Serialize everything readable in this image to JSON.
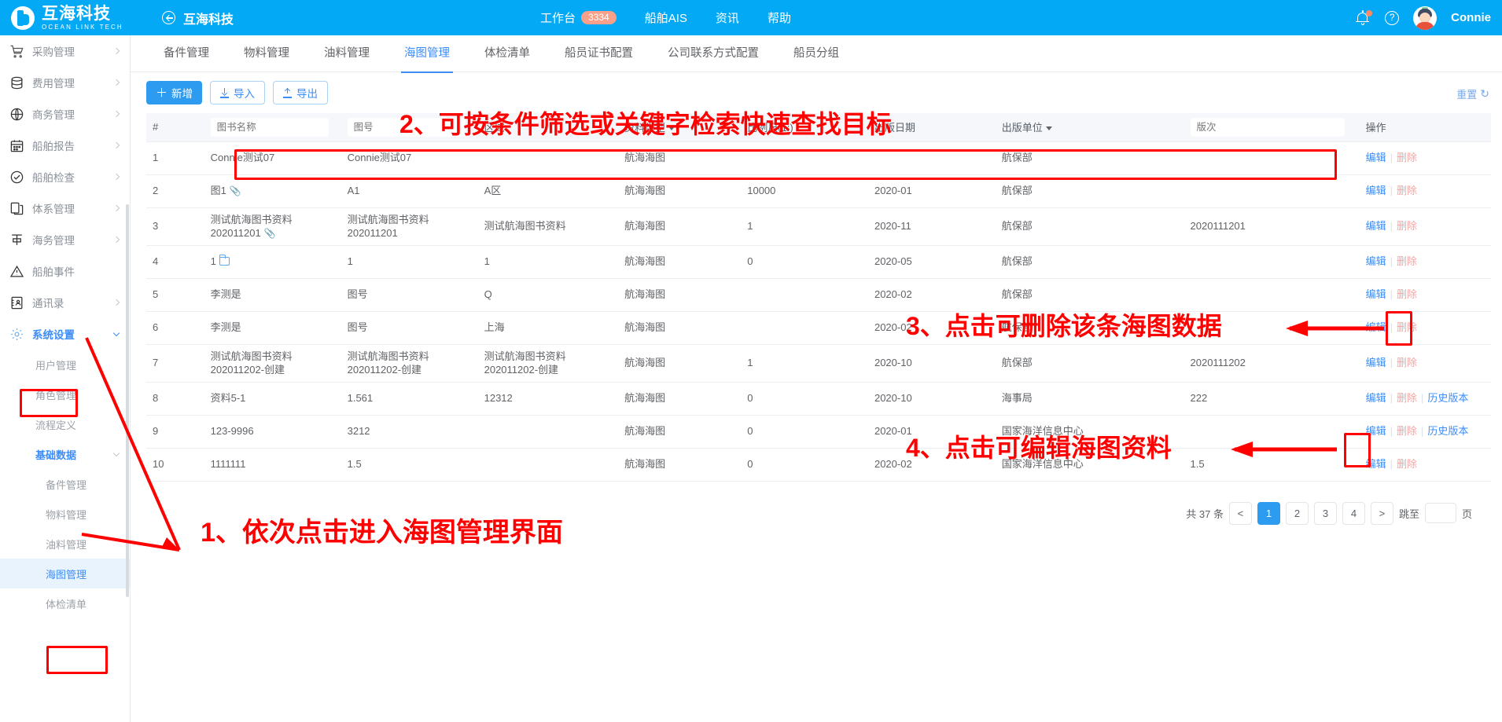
{
  "header": {
    "brand_cn": "互海科技",
    "brand_en": "OCEAN LINK TECH",
    "back_label": "互海科技",
    "nav": [
      {
        "label": "工作台",
        "badge": "3334"
      },
      {
        "label": "船舶AIS",
        "badge": ""
      },
      {
        "label": "资讯",
        "badge": ""
      },
      {
        "label": "帮助",
        "badge": ""
      }
    ],
    "user_name": "Connie"
  },
  "sidebar": {
    "items": [
      {
        "label": "采购管理",
        "icon": "cart-icon",
        "chevron": "right"
      },
      {
        "label": "费用管理",
        "icon": "database-icon",
        "chevron": "right"
      },
      {
        "label": "商务管理",
        "icon": "globe-icon",
        "chevron": "right"
      },
      {
        "label": "船舶报告",
        "icon": "calendar-icon",
        "chevron": "right"
      },
      {
        "label": "船舶检查",
        "icon": "check-circle-icon",
        "chevron": "right"
      },
      {
        "label": "体系管理",
        "icon": "documents-icon",
        "chevron": "right"
      },
      {
        "label": "海务管理",
        "icon": "anchor-icon",
        "chevron": "right"
      },
      {
        "label": "船舶事件",
        "icon": "warning-icon",
        "chevron": ""
      },
      {
        "label": "通讯录",
        "icon": "contacts-icon",
        "chevron": "right"
      },
      {
        "label": "系统设置",
        "icon": "gear-icon",
        "chevron": "down",
        "active": true
      }
    ],
    "sub_items": [
      {
        "label": "用户管理",
        "level": 1
      },
      {
        "label": "角色管理",
        "level": 1
      },
      {
        "label": "流程定义",
        "level": 1
      },
      {
        "label": "基础数据",
        "level": 1,
        "blue": true,
        "chevron": "down"
      },
      {
        "label": "备件管理",
        "level": 2
      },
      {
        "label": "物料管理",
        "level": 2
      },
      {
        "label": "油料管理",
        "level": 2
      },
      {
        "label": "海图管理",
        "level": 2,
        "selected": true
      },
      {
        "label": "体检清单",
        "level": 2
      }
    ]
  },
  "tabs": [
    {
      "label": "备件管理"
    },
    {
      "label": "物料管理"
    },
    {
      "label": "油料管理"
    },
    {
      "label": "海图管理",
      "active": true
    },
    {
      "label": "体检清单"
    },
    {
      "label": "船员证书配置"
    },
    {
      "label": "公司联系方式配置"
    },
    {
      "label": "船员分组"
    }
  ],
  "toolbar": {
    "add_label": "新增",
    "import_label": "导入",
    "export_label": "导出",
    "reset_label": "重置",
    "reset_glyph": "↻"
  },
  "table": {
    "columns": [
      {
        "key": "idx",
        "label": "#",
        "type": "text"
      },
      {
        "key": "book_name",
        "label": "",
        "type": "input",
        "placeholder": "图书名称"
      },
      {
        "key": "chart_no",
        "label": "",
        "type": "input",
        "placeholder": "图号"
      },
      {
        "key": "region",
        "label": "区域",
        "type": "text"
      },
      {
        "key": "data_type",
        "label": "资料类型",
        "type": "dropdown"
      },
      {
        "key": "scale",
        "label": "比例尺(1:)",
        "type": "text"
      },
      {
        "key": "pub_date",
        "label": "出版日期",
        "type": "text"
      },
      {
        "key": "pub_unit",
        "label": "出版单位",
        "type": "dropdown"
      },
      {
        "key": "edition",
        "label": "",
        "type": "input",
        "placeholder": "版次"
      },
      {
        "key": "actions",
        "label": "操作",
        "type": "text"
      }
    ],
    "rows": [
      {
        "idx": "1",
        "book_name": "Connie测试07",
        "attach": "",
        "chart_no": "Connie测试07",
        "region": "",
        "data_type": "航海海图",
        "scale": "",
        "pub_date": "",
        "pub_unit": "航保部",
        "edition": "",
        "actions": [
          "编辑",
          "删除"
        ]
      },
      {
        "idx": "2",
        "book_name": "图1",
        "attach": "clip",
        "chart_no": "A1",
        "region": "A区",
        "data_type": "航海海图",
        "scale": "10000",
        "pub_date": "2020-01",
        "pub_unit": "航保部",
        "edition": "",
        "actions": [
          "编辑",
          "删除"
        ]
      },
      {
        "idx": "3",
        "book_name": "测试航海图书资料202011201",
        "attach": "clip",
        "chart_no": "测试航海图书资料202011201",
        "region": "测试航海图书资料",
        "data_type": "航海海图",
        "scale": "1",
        "pub_date": "2020-11",
        "pub_unit": "航保部",
        "edition": "2020111201",
        "actions": [
          "编辑",
          "删除"
        ]
      },
      {
        "idx": "4",
        "book_name": "1",
        "attach": "folder",
        "chart_no": "1",
        "region": "1",
        "data_type": "航海海图",
        "scale": "0",
        "pub_date": "2020-05",
        "pub_unit": "航保部",
        "edition": "",
        "actions": [
          "编辑",
          "删除"
        ]
      },
      {
        "idx": "5",
        "book_name": "李测是",
        "attach": "",
        "chart_no": "图号",
        "region": "Q",
        "data_type": "航海海图",
        "scale": "",
        "pub_date": "2020-02",
        "pub_unit": "航保部",
        "edition": "",
        "actions": [
          "编辑",
          "删除"
        ]
      },
      {
        "idx": "6",
        "book_name": "李测是",
        "attach": "",
        "chart_no": "图号",
        "region": "上海",
        "data_type": "航海海图",
        "scale": "",
        "pub_date": "2020-02",
        "pub_unit": "航保部",
        "edition": "",
        "actions": [
          "编辑",
          "删除"
        ]
      },
      {
        "idx": "7",
        "book_name": "测试航海图书资料202011202-创建",
        "attach": "",
        "chart_no": "测试航海图书资料202011202-创建",
        "region": "测试航海图书资料202011202-创建",
        "data_type": "航海海图",
        "scale": "1",
        "pub_date": "2020-10",
        "pub_unit": "航保部",
        "edition": "2020111202",
        "actions": [
          "编辑",
          "删除"
        ]
      },
      {
        "idx": "8",
        "book_name": "资料5-1",
        "attach": "",
        "chart_no": "1.561",
        "region": "12312",
        "data_type": "航海海图",
        "scale": "0",
        "pub_date": "2020-10",
        "pub_unit": "海事局",
        "edition": "222",
        "actions": [
          "编辑",
          "删除",
          "历史版本"
        ]
      },
      {
        "idx": "9",
        "book_name": "123-9996",
        "attach": "",
        "chart_no": "3212",
        "region": "",
        "data_type": "航海海图",
        "scale": "0",
        "pub_date": "2020-01",
        "pub_unit": "国家海洋信息中心",
        "edition": "",
        "actions": [
          "编辑",
          "删除",
          "历史版本"
        ]
      },
      {
        "idx": "10",
        "book_name": "1111111",
        "attach": "",
        "chart_no": "1.5",
        "region": "",
        "data_type": "航海海图",
        "scale": "0",
        "pub_date": "2020-02",
        "pub_unit": "国家海洋信息中心",
        "edition": "1.5",
        "actions": [
          "编辑",
          "删除"
        ]
      }
    ]
  },
  "pagination": {
    "total_label": "共 37 条",
    "prev": "<",
    "pages": [
      "1",
      "2",
      "3",
      "4"
    ],
    "current_page": "1",
    "next": ">",
    "jump_label": "跳至",
    "jump_value": "",
    "page_unit": "页"
  },
  "annotations": [
    {
      "id": "anno-1",
      "text": "1、依次点击进入海图管理界面"
    },
    {
      "id": "anno-2",
      "text": "2、可按条件筛选或关键字检索快速查找目标"
    },
    {
      "id": "anno-3",
      "text": "3、点击可删除该条海图数据"
    },
    {
      "id": "anno-4",
      "text": "4、点击可编辑海图资料"
    }
  ],
  "colors": {
    "brand_blue": "#03a9f4",
    "accent_blue": "#3d8df5",
    "annotation_red": "#fe0000",
    "delete_pink": "#f9a3a3"
  }
}
